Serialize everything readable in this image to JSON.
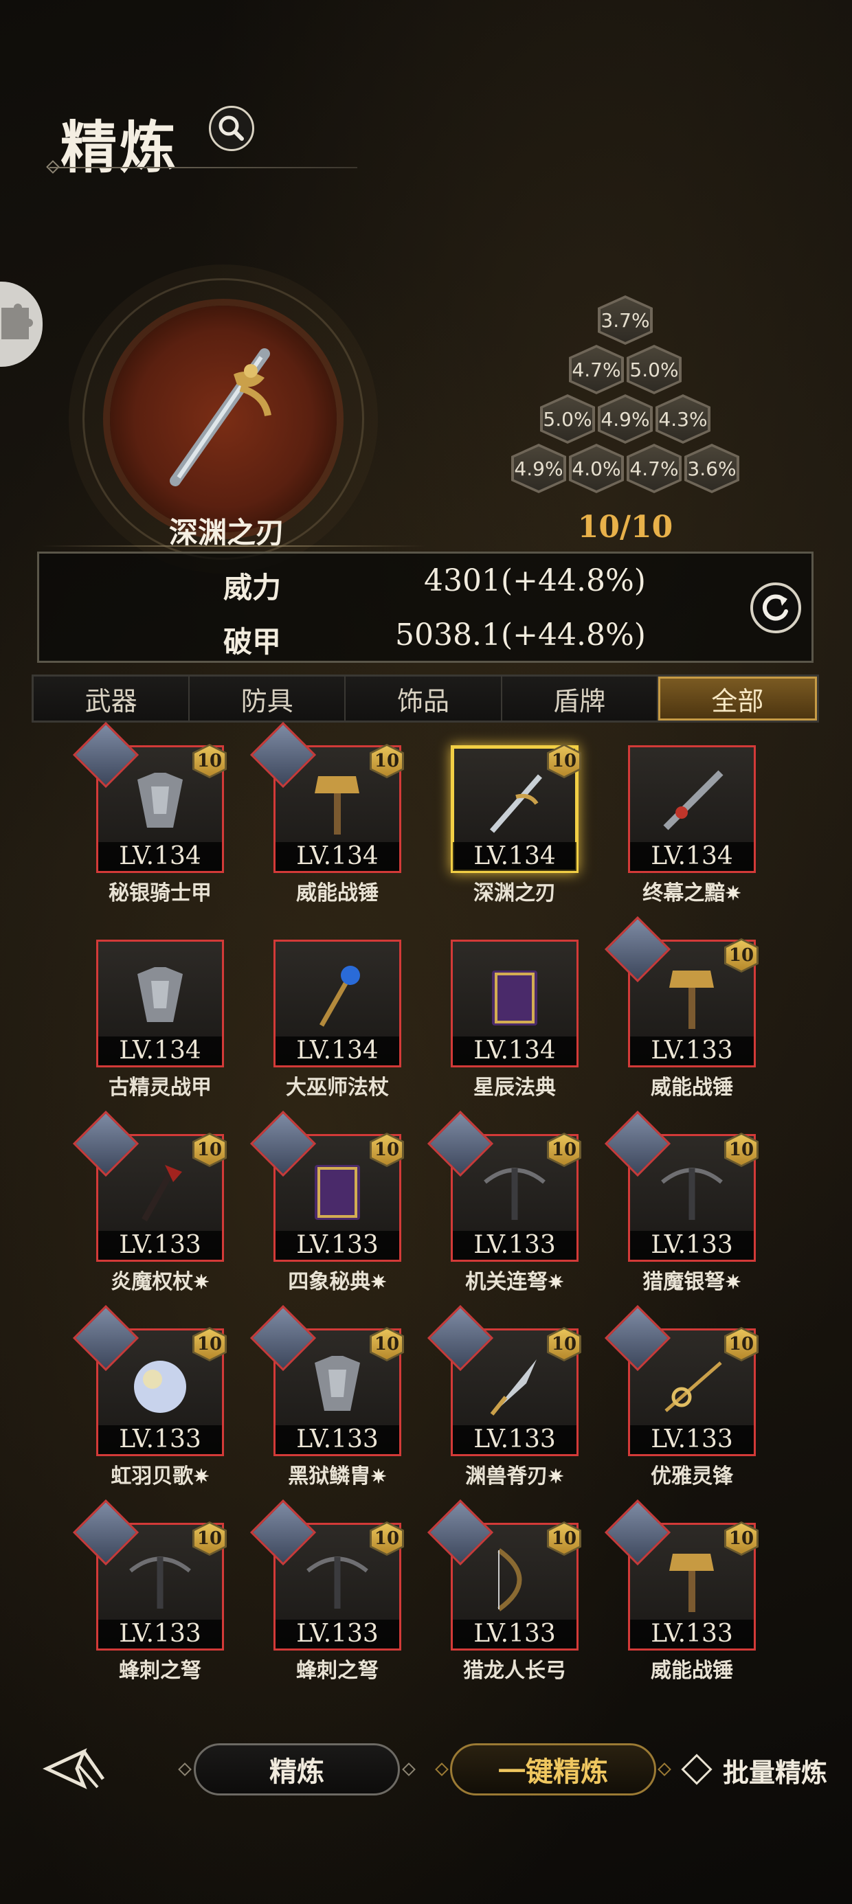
{
  "header": {
    "title": "精炼",
    "search_icon": "magnifier-icon"
  },
  "featured": {
    "name": "深渊之刃",
    "icon": "dagger-icon",
    "progress": "10/10",
    "honeycomb": [
      "3.7%",
      "4.7%",
      "5.0%",
      "5.0%",
      "4.9%",
      "4.3%",
      "4.9%",
      "4.0%",
      "4.7%",
      "3.6%"
    ]
  },
  "stats": [
    {
      "label": "威力",
      "value": "4301(+44.8%)"
    },
    {
      "label": "破甲",
      "value": "5038.1(+44.8%)"
    }
  ],
  "tabs": [
    "武器",
    "防具",
    "饰品",
    "盾牌",
    "全部"
  ],
  "active_tab": "全部",
  "items": [
    {
      "name": "秘银骑士甲",
      "level": "LV.134",
      "refine": "10",
      "star": false,
      "portrait": true,
      "icon": "armor-icon"
    },
    {
      "name": "威能战锤",
      "level": "LV.134",
      "refine": "10",
      "star": false,
      "portrait": true,
      "icon": "hammer-icon"
    },
    {
      "name": "深渊之刃",
      "level": "LV.134",
      "refine": "10",
      "star": false,
      "portrait": false,
      "icon": "dagger-icon",
      "selected": true
    },
    {
      "name": "终幕之黯",
      "level": "LV.134",
      "refine": "",
      "star": true,
      "portrait": false,
      "icon": "sword-icon"
    },
    {
      "name": "古精灵战甲",
      "level": "LV.134",
      "refine": "",
      "star": false,
      "portrait": false,
      "icon": "armor-icon"
    },
    {
      "name": "大巫师法杖",
      "level": "LV.134",
      "refine": "",
      "star": false,
      "portrait": false,
      "icon": "staff-icon"
    },
    {
      "name": "星辰法典",
      "level": "LV.134",
      "refine": "",
      "star": false,
      "portrait": false,
      "icon": "book-icon"
    },
    {
      "name": "威能战锤",
      "level": "LV.133",
      "refine": "10",
      "star": false,
      "portrait": true,
      "icon": "hammer-icon"
    },
    {
      "name": "炎魔权杖",
      "level": "LV.133",
      "refine": "10",
      "star": true,
      "portrait": true,
      "icon": "scepter-icon"
    },
    {
      "name": "四象秘典",
      "level": "LV.133",
      "refine": "10",
      "star": true,
      "portrait": true,
      "icon": "book-icon"
    },
    {
      "name": "机关连弩",
      "level": "LV.133",
      "refine": "10",
      "star": true,
      "portrait": true,
      "icon": "crossbow-icon"
    },
    {
      "name": "猎魔银弩",
      "level": "LV.133",
      "refine": "10",
      "star": true,
      "portrait": true,
      "icon": "crossbow-icon"
    },
    {
      "name": "虹羽贝歌",
      "level": "LV.133",
      "refine": "10",
      "star": true,
      "portrait": true,
      "icon": "orb-icon"
    },
    {
      "name": "黑狱鳞胄",
      "level": "LV.133",
      "refine": "10",
      "star": true,
      "portrait": true,
      "icon": "armor-icon"
    },
    {
      "name": "渊兽脊刃",
      "level": "LV.133",
      "refine": "10",
      "star": true,
      "portrait": true,
      "icon": "blade-icon"
    },
    {
      "name": "优雅灵锋",
      "level": "LV.133",
      "refine": "10",
      "star": false,
      "portrait": true,
      "icon": "rapier-icon"
    },
    {
      "name": "蜂刺之弩",
      "level": "LV.133",
      "refine": "10",
      "star": false,
      "portrait": true,
      "icon": "crossbow-icon"
    },
    {
      "name": "蜂刺之弩",
      "level": "LV.133",
      "refine": "10",
      "star": false,
      "portrait": true,
      "icon": "crossbow-icon"
    },
    {
      "name": "猎龙人长弓",
      "level": "LV.133",
      "refine": "10",
      "star": false,
      "portrait": true,
      "icon": "bow-icon"
    },
    {
      "name": "威能战锤",
      "level": "LV.133",
      "refine": "10",
      "star": false,
      "portrait": true,
      "icon": "hammer-icon"
    }
  ],
  "star_glyph": "✷",
  "footer": {
    "refine_label": "精炼",
    "onekey_label": "一键精炼",
    "batch_label": "批量精炼",
    "back_icon": "back-arrow-icon"
  },
  "colors": {
    "accent_gold": "#e8b14a",
    "rarity_red": "#d33a38",
    "selected_gold": "#f2cf45"
  }
}
